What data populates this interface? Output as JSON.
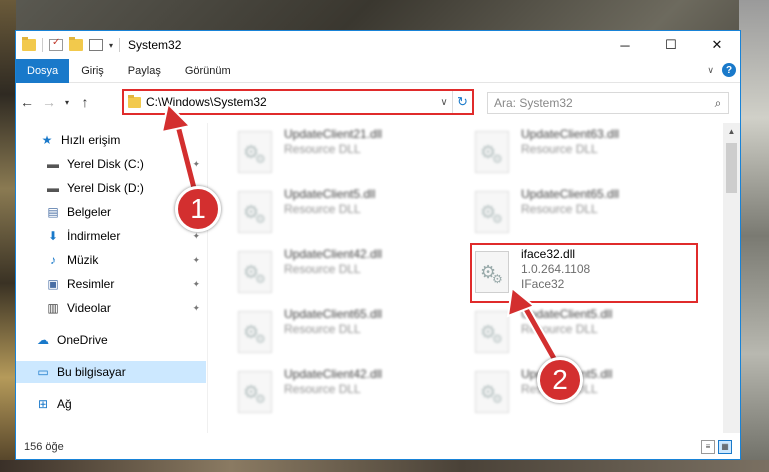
{
  "window": {
    "title": "System32",
    "controls": {
      "minimize": "─",
      "maximize": "☐",
      "close": "✕"
    }
  },
  "ribbon": {
    "tabs": [
      "Dosya",
      "Giriş",
      "Paylaş",
      "Görünüm"
    ],
    "help": "?"
  },
  "navigation": {
    "back": "←",
    "forward": "→",
    "recent": "▾",
    "up": "↑",
    "address": "C:\\Windows\\System32",
    "refresh": "↻",
    "search_placeholder": "Ara: System32",
    "search_icon": "⌕"
  },
  "sidebar": {
    "items": [
      {
        "label": "Hızlı erişim",
        "icon": "star-icon",
        "glyph": "★",
        "pinned": false
      },
      {
        "label": "Yerel Disk (C:)",
        "icon": "drive-icon",
        "glyph": "▬",
        "pinned": true
      },
      {
        "label": "Yerel Disk (D:)",
        "icon": "drive-icon",
        "glyph": "▬",
        "pinned": true
      },
      {
        "label": "Belgeler",
        "icon": "documents-icon",
        "glyph": "▤",
        "pinned": true
      },
      {
        "label": "İndirmeler",
        "icon": "download-icon",
        "glyph": "⬇",
        "pinned": true
      },
      {
        "label": "Müzik",
        "icon": "music-icon",
        "glyph": "♪",
        "pinned": true
      },
      {
        "label": "Resimler",
        "icon": "pictures-icon",
        "glyph": "▣",
        "pinned": true
      },
      {
        "label": "Videolar",
        "icon": "video-icon",
        "glyph": "▥",
        "pinned": true
      },
      {
        "label": "OneDrive",
        "icon": "cloud-icon",
        "glyph": "☁",
        "pinned": false
      },
      {
        "label": "Bu bilgisayar",
        "icon": "computer-icon",
        "glyph": "▭",
        "pinned": false,
        "selected": true
      },
      {
        "label": "Ağ",
        "icon": "network-icon",
        "glyph": "⊞",
        "pinned": false
      }
    ],
    "pin_glyph": "📌"
  },
  "files": [
    {
      "name": "UpdateClient21.dll",
      "type": "Resource DLL"
    },
    {
      "name": "UpdateClient63.dll",
      "type": "Resource DLL"
    },
    {
      "name": "UpdateClient5.dll",
      "type": "Resource DLL"
    },
    {
      "name": "UpdateClient65.dll",
      "type": "Resource DLL"
    },
    {
      "name": "UpdateClient42.dll",
      "type": "Resource DLL"
    },
    {
      "name": "iface32.dll",
      "version": "1.0.264.1108",
      "type": "IFace32",
      "highlighted": true
    },
    {
      "name": "UpdateClient65.dll",
      "type": "Resource DLL"
    },
    {
      "name": "UpdateClient5.dll",
      "type": "Resource DLL"
    },
    {
      "name": "UpdateClient42.dll",
      "type": "Resource DLL"
    },
    {
      "name": "UpdateClient5.dll",
      "type": "Resource DLL"
    }
  ],
  "status": {
    "item_count": "156 öğe"
  },
  "annotations": {
    "step1": "1",
    "step2": "2",
    "color": "#d32f2f"
  }
}
